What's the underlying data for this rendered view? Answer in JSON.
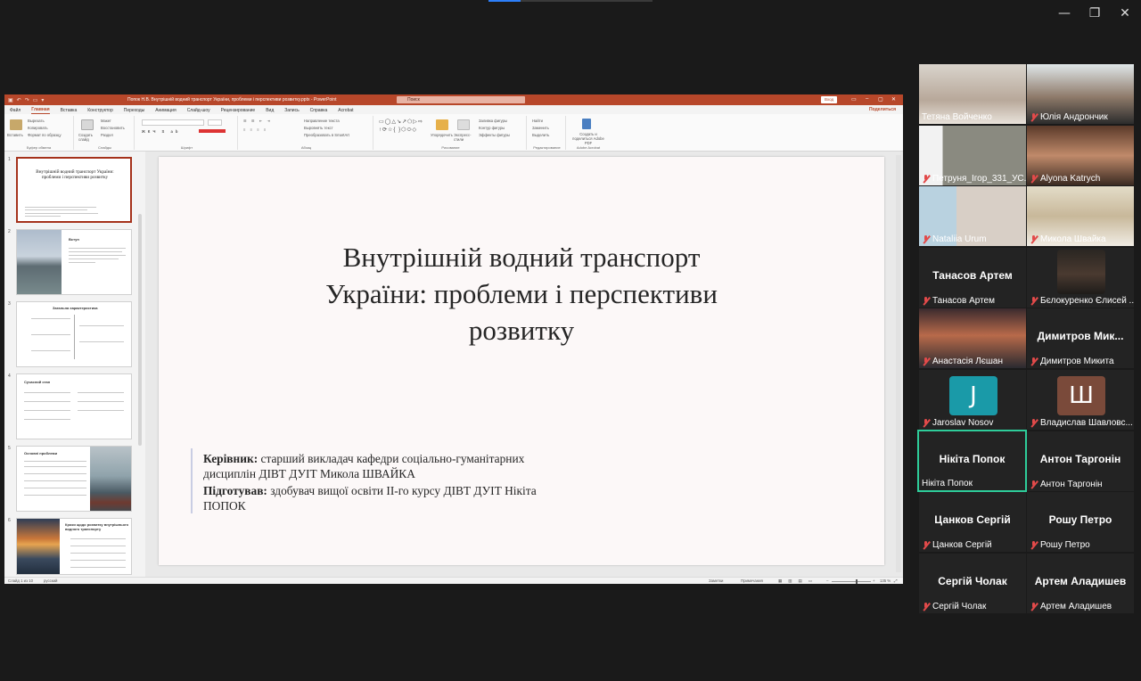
{
  "window": {
    "minimize_glyph": "—",
    "restore_glyph": "❐",
    "close_glyph": "✕"
  },
  "powerpoint": {
    "doc_title": "Попок Н.В. Внутрішній водний транспорт України, проблеми і перспективи розвитку.pptx  -  PowerPoint",
    "search_placeholder": "Поиск",
    "signin": "Вход",
    "menu": [
      "Файл",
      "Главная",
      "Вставка",
      "Конструктор",
      "Переходы",
      "Анимация",
      "Слайд-шоу",
      "Рецензирование",
      "Вид",
      "Запись",
      "Справка",
      "Acrobat"
    ],
    "share": "Поделиться",
    "ribbon": {
      "paste": "Вставить",
      "cut": "Вырезать",
      "copy": "Копировать",
      "format_painter": "Формат по образцу",
      "clipboard_group": "Буфер обмена",
      "new_slide": "Создать слайд",
      "layout": "Макет",
      "reset": "Восстановить",
      "section": "Раздел",
      "slides_group": "Слайды",
      "font_group": "Шрифт",
      "text_direction": "Направление текста",
      "align_text": "Выровнять текст",
      "smartart": "Преобразовать в SmartArt",
      "paragraph_group": "Абзац",
      "arrange": "Упорядочить",
      "quick_styles": "Экспресс-стили",
      "shape_fill": "Заливка фигуры",
      "shape_outline": "Контур фигуры",
      "shape_effects": "Эффекты фигуры",
      "drawing_group": "Рисование",
      "find": "Найти",
      "replace": "Заменить",
      "select": "Выделить",
      "editing_group": "Редактирование",
      "create_pdf": "Создать и поделиться Adobe PDF",
      "acrobat_group": "Adobe Acrobat"
    },
    "thumbnails": [
      {
        "num": "1",
        "title": "Внутрішній водний транспорт України: проблеми і перспективи розвитку"
      },
      {
        "num": "2",
        "title": "Вступ"
      },
      {
        "num": "3",
        "title": "Загальна характеристика"
      },
      {
        "num": "4",
        "title": "Сучасний стан"
      },
      {
        "num": "5",
        "title": "Основні проблеми"
      },
      {
        "num": "6",
        "title": "Кроки щодо розвитку внутрішнього водного транспорту"
      }
    ],
    "slide": {
      "title": "Внутрішній водний транспорт України: проблеми і перспективи розвитку",
      "supervisor_label": "Керівник:",
      "supervisor_text": " старший викладач кафедри соціально-гуманітарних дисциплін ДІВТ ДУІТ Микола ШВАЙКА",
      "prepared_label": "Підготував:",
      "prepared_text": " здобувач вищої освіти ІІ-го курсу ДІВТ ДУІТ Нікіта ПОПОК"
    },
    "status": {
      "slide_counter": "Слайд 1 из 10",
      "language": "русский",
      "notes": "Заметки",
      "comments": "Примечания",
      "zoom": "135 %"
    }
  },
  "participants": [
    {
      "name": "Тетяна Войченко",
      "muted": false,
      "big": ""
    },
    {
      "name": "Юлія Андрончик",
      "muted": true,
      "big": ""
    },
    {
      "name": "Петруня_Ігор_331_УС...",
      "muted": true,
      "big": ""
    },
    {
      "name": "Alyona Katrych",
      "muted": true,
      "big": ""
    },
    {
      "name": "Nataliia Urum",
      "muted": true,
      "big": ""
    },
    {
      "name": "Микола Швайка",
      "muted": true,
      "big": ""
    },
    {
      "name": "Танасов Артем",
      "muted": true,
      "big": "Танасов Артем"
    },
    {
      "name": "Бєлокуренко Єлисей ...",
      "muted": true,
      "big": ""
    },
    {
      "name": "Анастасія Лєшан",
      "muted": true,
      "big": ""
    },
    {
      "name": "Димитров Микита",
      "muted": true,
      "big": "Димитров   Мик..."
    },
    {
      "name": "Jaroslav Nosov",
      "muted": true,
      "big": "",
      "letter": "J"
    },
    {
      "name": "Владислав Шавловс...",
      "muted": true,
      "big": "",
      "letter": "Ш"
    },
    {
      "name": "Нікіта Попок",
      "muted": false,
      "big": "Нікіта Попок"
    },
    {
      "name": "Антон Таргонін",
      "muted": true,
      "big": "Антон Таргонін"
    },
    {
      "name": "Цанков Сергій",
      "muted": true,
      "big": "Цанков Сергій"
    },
    {
      "name": "Рошу Петро",
      "muted": true,
      "big": "Рошу Петро"
    },
    {
      "name": "Сергій Чолак",
      "muted": true,
      "big": "Сергій Чолак"
    },
    {
      "name": "Артем Аладишев",
      "muted": true,
      "big": "Артем Аладишев"
    }
  ],
  "colors": {
    "ppt_accent": "#b7472a",
    "active_speaker": "#2ecc9a",
    "mute_red": "#e24a4a",
    "avatar_teal": "#1a9aa8",
    "avatar_brown": "#7a4a3a"
  }
}
